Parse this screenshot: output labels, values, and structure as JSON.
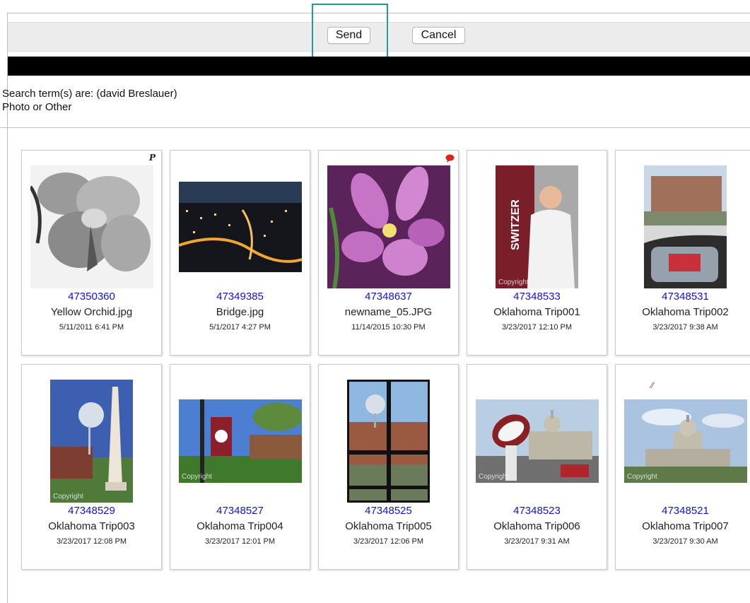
{
  "toolbar": {
    "send_label": "Send",
    "cancel_label": "Cancel"
  },
  "search": {
    "terms_line": "Search term(s) are: (david Breslauer)",
    "type_line": "Photo or Other"
  },
  "items": [
    {
      "id": "47350360",
      "name": "Yellow Orchid.jpg",
      "date": "5/11/2011 6:41 PM",
      "badge": "P"
    },
    {
      "id": "47349385",
      "name": "Bridge.jpg",
      "date": "5/1/2017 4:27 PM"
    },
    {
      "id": "47348637",
      "name": "newname_05.JPG",
      "date": "11/14/2015 10:30 PM"
    },
    {
      "id": "47348533",
      "name": "Oklahoma Trip001",
      "date": "3/23/2017 12:10 PM"
    },
    {
      "id": "47348531",
      "name": "Oklahoma Trip002",
      "date": "3/23/2017 9:38 AM"
    },
    {
      "id": "47348529",
      "name": "Oklahoma Trip003",
      "date": "3/23/2017 12:08 PM"
    },
    {
      "id": "47348527",
      "name": "Oklahoma Trip004",
      "date": "3/23/2017 12:01 PM"
    },
    {
      "id": "47348525",
      "name": "Oklahoma Trip005",
      "date": "3/23/2017 12:06 PM"
    },
    {
      "id": "47348523",
      "name": "Oklahoma Trip006",
      "date": "3/23/2017 9:31 AM"
    },
    {
      "id": "47348521",
      "name": "Oklahoma Trip007",
      "date": "3/23/2017 9:30 AM"
    }
  ],
  "thumb_text": {
    "copyright": "Copyright",
    "switzer": "SWITZER"
  },
  "colors": {
    "highlight": "#1e9c95",
    "link": "#1111dd",
    "comment_badge": "#e0201a"
  }
}
